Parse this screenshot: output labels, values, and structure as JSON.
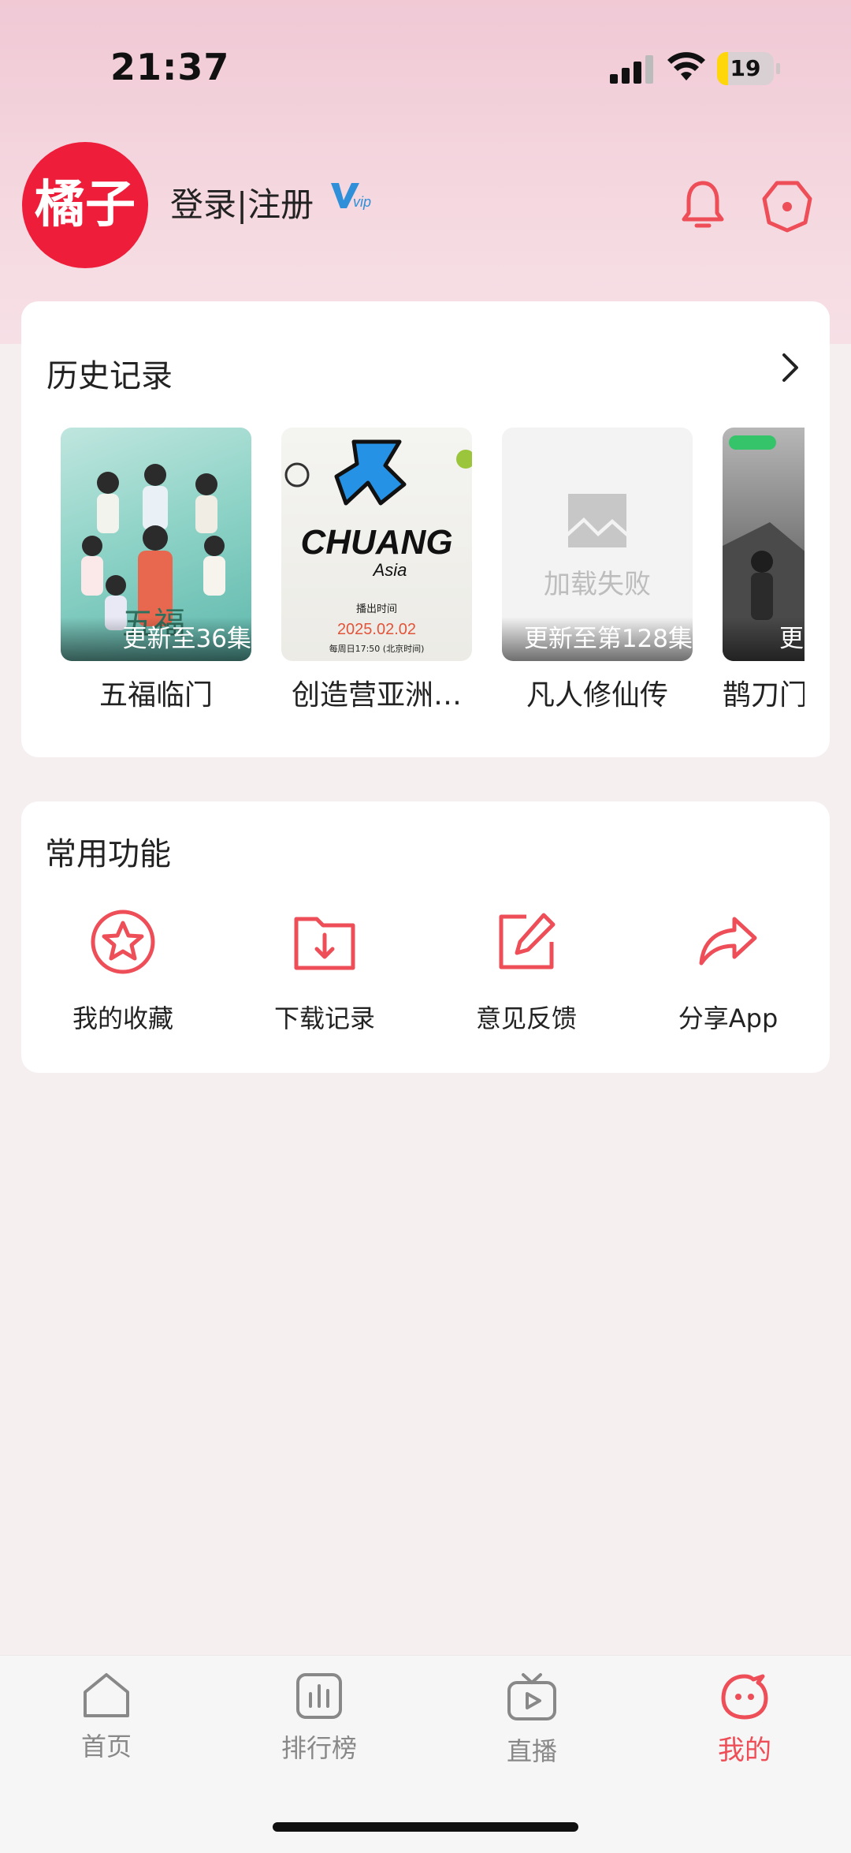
{
  "status_bar": {
    "time": "21:37",
    "battery": "19",
    "battery_level": 0.19
  },
  "profile": {
    "avatar_text": "橘子",
    "login_label": "登录|注册",
    "vip_badge": "V",
    "vip_badge_sub": "vip"
  },
  "history": {
    "title": "历史记录",
    "items": [
      {
        "title": "五福临门",
        "badge": "更新至36集",
        "poster_text": "五福"
      },
      {
        "title": "创造营亚洲…",
        "badge": "",
        "poster_text": "CHUANG",
        "poster_sub": "Asia",
        "poster_time_label": "播出时间",
        "poster_date": "2025.02.02",
        "poster_note": "每周日17:50 (北京时间)"
      },
      {
        "title": "凡人修仙传",
        "badge": "更新至第128集",
        "poster_text": "加载失败"
      },
      {
        "title": "鹊刀门",
        "badge": "更",
        "poster_text": ""
      }
    ]
  },
  "functions": {
    "title": "常用功能",
    "items": [
      {
        "label": "我的收藏",
        "icon": "star-icon"
      },
      {
        "label": "下载记录",
        "icon": "download-folder-icon"
      },
      {
        "label": "意见反馈",
        "icon": "edit-icon"
      },
      {
        "label": "分享App",
        "icon": "share-icon"
      }
    ]
  },
  "tabbar": {
    "items": [
      {
        "label": "首页",
        "icon": "home-icon",
        "active": false
      },
      {
        "label": "排行榜",
        "icon": "chart-icon",
        "active": false
      },
      {
        "label": "直播",
        "icon": "tv-icon",
        "active": false
      },
      {
        "label": "我的",
        "icon": "face-icon",
        "active": true
      }
    ]
  },
  "colors": {
    "accent": "#ee4e57",
    "avatar_bg": "#ee1d3a",
    "vip": "#2f8fd8"
  }
}
